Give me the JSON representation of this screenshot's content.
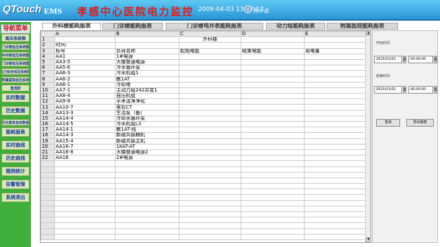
{
  "header": {
    "logo": "QTouch",
    "system": "EMS",
    "title": "孝感中心医院电力监控",
    "datetime": "2009-04-03 13:17:12",
    "user": "用小此"
  },
  "sidebar": {
    "heading": "导航菜单",
    "items": [
      {
        "label": "高压系统图",
        "style": "normal"
      },
      {
        "label": "门诊楼低压系统图",
        "style": "small"
      },
      {
        "label": "外科楼低压系统图",
        "style": "small"
      },
      {
        "label": "门诊楼低压系统图",
        "style": "small"
      },
      {
        "label": "电力综合低压系统图",
        "style": "small"
      },
      {
        "label": "附属医院低压系统",
        "style": "small"
      },
      {
        "label": "直流屏",
        "style": "small"
      },
      {
        "label": "实时数据",
        "style": "big"
      },
      {
        "label": "历史数据",
        "style": "big"
      },
      {
        "label": "历史报表自动数据",
        "style": "small"
      },
      {
        "label": "能耗报表",
        "style": "big"
      },
      {
        "label": "实时曲线",
        "style": "big"
      },
      {
        "label": "历史曲线",
        "style": "big"
      },
      {
        "label": "图例统计",
        "style": "big"
      },
      {
        "label": "告警管理",
        "style": "big"
      },
      {
        "label": "系统退出",
        "style": "big"
      }
    ]
  },
  "tabs": [
    {
      "label": "外科楼能耗报表",
      "active": true
    },
    {
      "label": "门诊楼能耗报表",
      "active": false
    },
    {
      "label": "门诊楼电井表能耗报表",
      "active": false
    },
    {
      "label": "动力组能耗报表",
      "active": false
    },
    {
      "label": "附属医院能耗报表",
      "active": false
    }
  ],
  "sheet": {
    "columns": [
      "A",
      "B",
      "C",
      "D",
      "E"
    ],
    "rows": [
      [
        "",
        "",
        "外科楼",
        "",
        ""
      ],
      [
        "时间:",
        "",
        "",
        "",
        ""
      ],
      [
        "标号",
        "负荷名称",
        "起始电能",
        "结束电能",
        "用电量"
      ],
      [
        "AA1",
        "1#电源",
        "",
        "",
        ""
      ],
      [
        "AA3-5",
        "大楼普通电源",
        "",
        "",
        ""
      ],
      [
        "AA5-6",
        "冷水循环泵",
        "",
        "",
        ""
      ],
      [
        "AA6-3",
        "冷水机组1",
        "",
        "",
        ""
      ],
      [
        "AA6-2",
        "教1AT",
        "",
        "",
        ""
      ],
      [
        "AA6-1",
        "冷却塔",
        "",
        "",
        ""
      ],
      [
        "AA7-1",
        "主动力组242井变1",
        "",
        "",
        ""
      ],
      [
        "AA8-4",
        "自压机组",
        "",
        "",
        ""
      ],
      [
        "AA9-8",
        "手术洁净净化",
        "",
        "",
        ""
      ],
      [
        "AA10-7",
        "室右CT",
        "",
        "",
        ""
      ],
      [
        "AA13-3",
        "生活泵（备）",
        "",
        "",
        ""
      ],
      [
        "AA14-4",
        "冷却水循环泵",
        "",
        "",
        ""
      ],
      [
        "AA14-5",
        "冷水机组L3",
        "",
        "",
        ""
      ],
      [
        "AA14-1",
        "教1AT-线",
        "",
        "",
        ""
      ],
      [
        "AA14-3",
        "新磁共振耦机",
        "",
        "",
        ""
      ],
      [
        "AA15-4",
        "新磁共振主机",
        "",
        "",
        ""
      ],
      [
        "AA16-7",
        "1KAT-AT",
        "",
        "",
        ""
      ],
      [
        "AA16-8",
        "大楼普通电源2",
        "",
        "",
        ""
      ],
      [
        "AA18",
        "2#电源",
        "",
        "",
        ""
      ]
    ]
  },
  "panel": {
    "start_label": "开始时间",
    "start_date": "2015/01/01",
    "start_time": "00:00:00",
    "end_label": "结束时间",
    "end_date": "2015/01/01",
    "end_time": "00:00:00",
    "query_button": "查询",
    "export_button": "导出报表"
  },
  "colors": {
    "header_bg": "#2b95d6",
    "title_red": "#d81e1e",
    "sidebar_green": "#3fae3a"
  }
}
